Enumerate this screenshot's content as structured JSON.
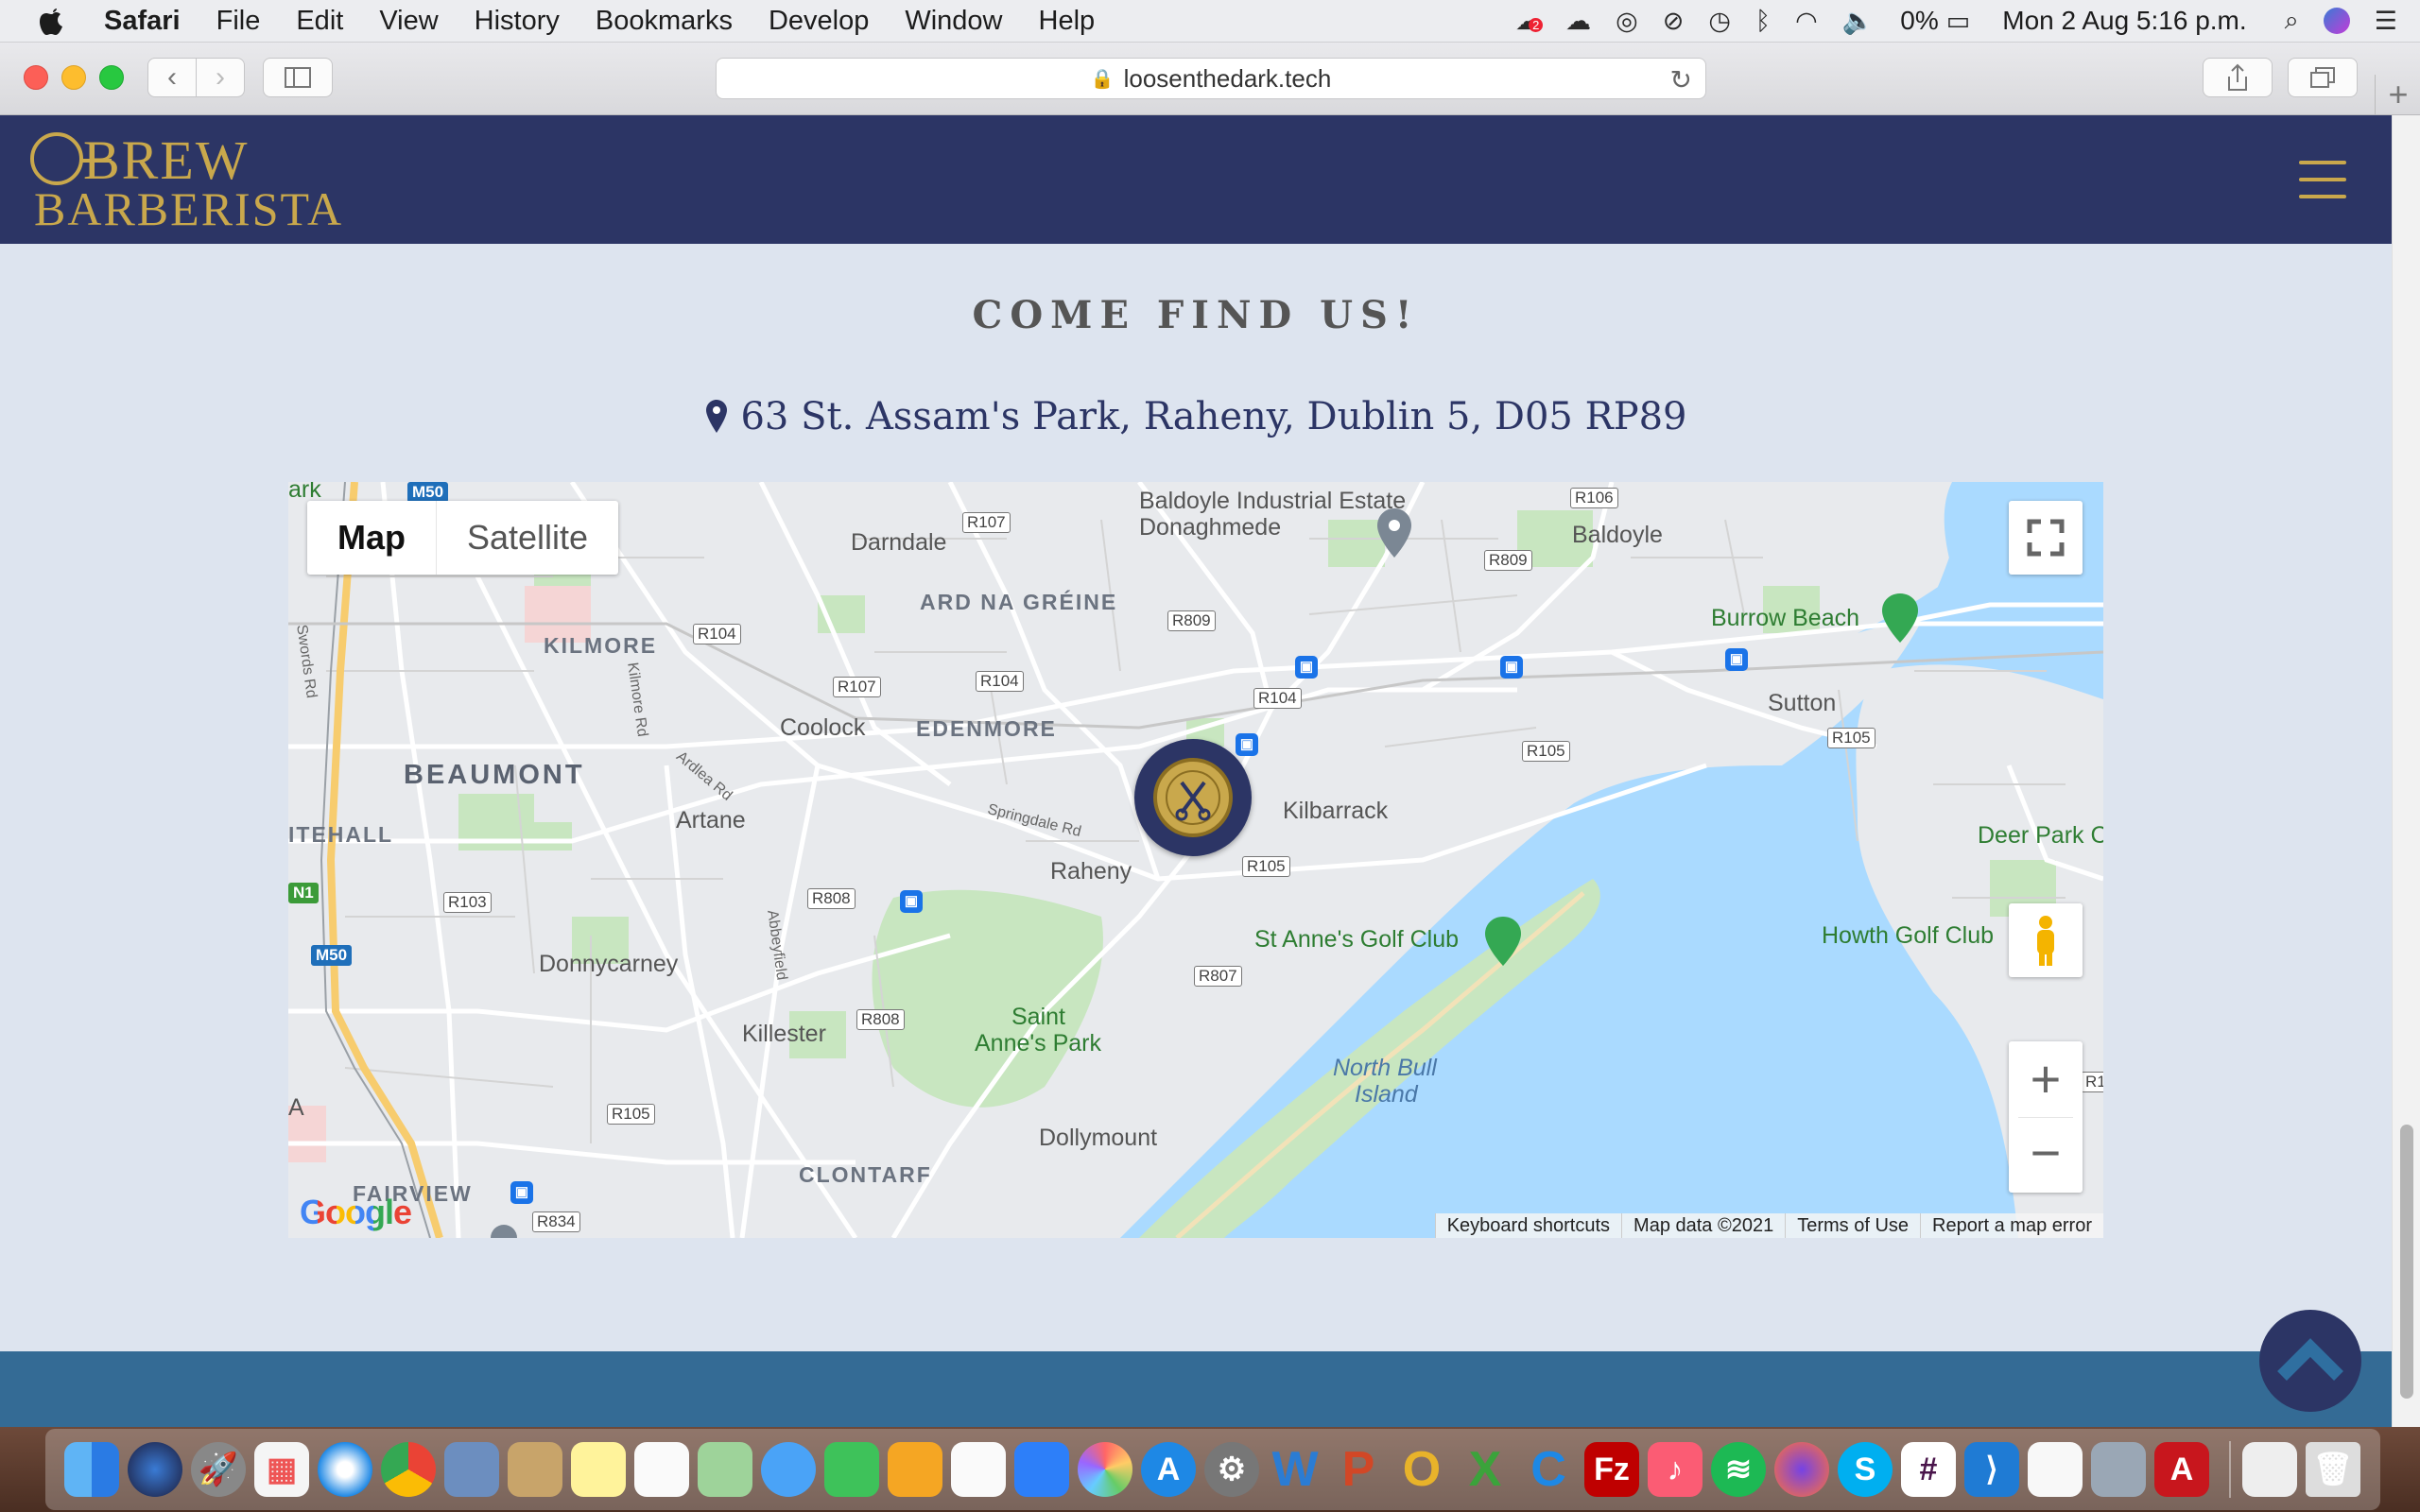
{
  "menubar": {
    "app_name": "Safari",
    "menus": [
      "File",
      "Edit",
      "View",
      "History",
      "Bookmarks",
      "Develop",
      "Window",
      "Help"
    ],
    "battery": "0%",
    "datetime": "Mon 2 Aug  5:16 p.m.",
    "notification_count": "2"
  },
  "browser": {
    "url": "loosenthedark.tech"
  },
  "site": {
    "logo_top": "BREW",
    "logo_bottom": "BARBERISTA",
    "heading": "COME FIND US!",
    "address": "63 St. Assam's Park, Raheny, Dublin 5, D05 RP89"
  },
  "map": {
    "type_map": "Map",
    "type_satellite": "Satellite",
    "zoom_in": "+",
    "zoom_out": "−",
    "google": "Google",
    "footer": [
      "Keyboard shortcuts",
      "Map data ©2021",
      "Terms of Use",
      "Report a map error"
    ],
    "places": {
      "baldoyle_ind": "Baldoyle Industrial Estate",
      "donaghmede": "Donaghmede",
      "baldoyle": "Baldoyle",
      "darndale": "Darndale",
      "ard_na_greine": "ARD NA GRÉINE",
      "kilmore": "KILMORE",
      "burrow_beach": "Burrow Beach",
      "sutton": "Sutton",
      "coolock": "Coolock",
      "edenmore": "EDENMORE",
      "beaumont": "BEAUMONT",
      "itehall": "ITEHALL",
      "artane": "Artane",
      "kilbarrack": "Kilbarrack",
      "raheny": "Raheny",
      "deer_park": "Deer Park C",
      "st_annes_golf": "St Anne's Golf Club",
      "howth_golf": "Howth Golf Club",
      "donnycarney": "Donnycarney",
      "saint_annes_park_1": "Saint",
      "saint_annes_park_2": "Anne's Park",
      "north_bull_1": "North Bull",
      "north_bull_2": "Island",
      "killester": "Killester",
      "dollymount": "Dollymount",
      "clontarf": "CLONTARF",
      "fairview": "FAIRVIEW",
      "swords_rd": "Swords Rd",
      "kilmore_rd": "Kilmore Rd",
      "ardlea_rd": "Ardlea Rd",
      "springdale_rd": "Springdale Rd",
      "abbeyfield": "Abbeyfield",
      "edge_ark": "ark",
      "edge_a": "A"
    },
    "roads": {
      "r107a": "R107",
      "r106": "R106",
      "r809a": "R809",
      "r809b": "R809",
      "r104a": "R104",
      "r107b": "R107",
      "r104b": "R104",
      "r104c": "R104",
      "r105a": "R105",
      "r105b": "R105",
      "r105c": "R105",
      "r103": "R103",
      "r808a": "R808",
      "r808b": "R808",
      "r807": "R807",
      "r105d": "R105",
      "r834": "R834",
      "m50a": "M50",
      "m50b": "M50",
      "n1": "N1",
      "r1": "R1"
    }
  }
}
